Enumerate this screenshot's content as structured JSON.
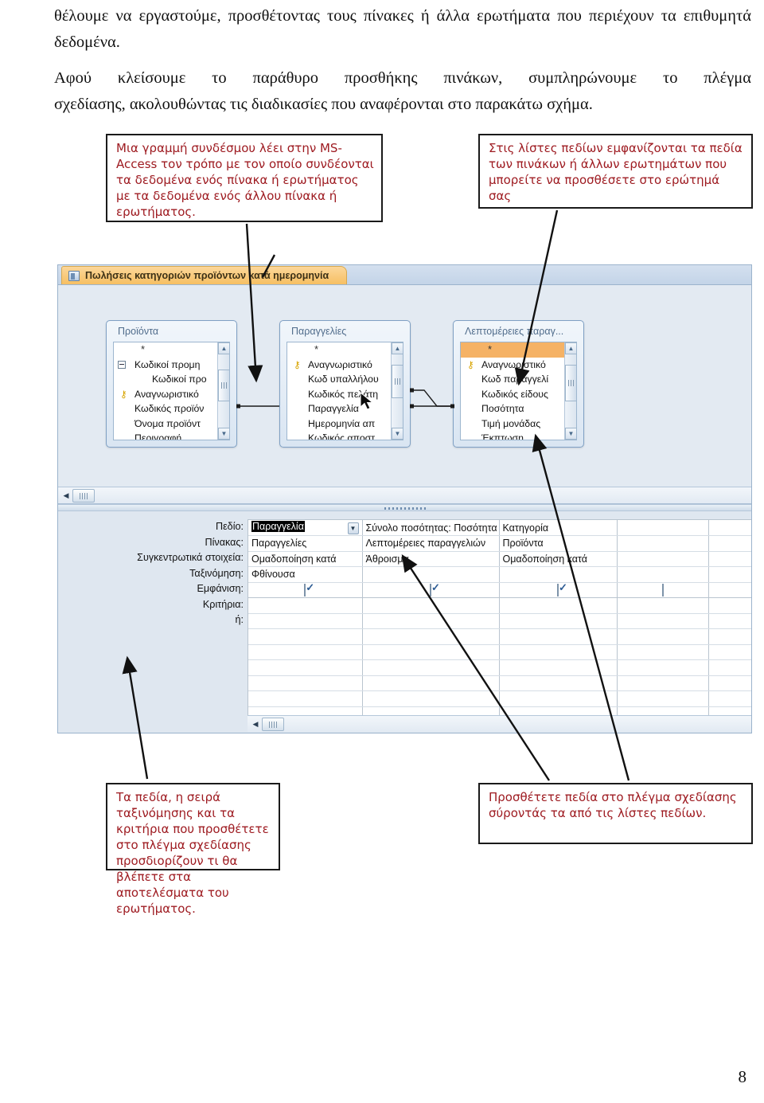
{
  "document": {
    "paragraph_1": "θέλουμε να εργαστούμε, προσθέτοντας τους πίνακες ή άλλα ερωτήματα που περιέχουν τα επιθυμητά δεδομένα.",
    "paragraph_2_line_1": "Αφού κλείσουμε το παράθυρο προσθήκης πινάκων, συμπληρώνουμε το πλέγμα",
    "paragraph_2_line_2": "σχεδίασης, ακολουθώντας τις διαδικασίες που αναφέρονται στο παρακάτω σχήμα.",
    "page_number": "8"
  },
  "callouts": {
    "link_line": "Μια γραμμή συνδέσμου λέει στην MS-Access τον τρόπο με τον οποίο συνδέονται τα δεδομένα ενός πίνακα ή ερωτήματος με τα δεδομένα ενός άλλου πίνακα ή ερωτήματος.",
    "field_lists": "Στις λίστες πεδίων εμφανίζονται τα πεδία των πινάκων ή άλλων ερωτημάτων που μπορείτε να προσθέσετε στο ερώτημά σας",
    "design_grid": "Τα πεδία, η σειρά ταξινόμησης και τα κριτήρια που προσθέτετε στο πλέγμα σχεδίασης προσδιορίζουν τι θα βλέπετε στα αποτελέσματα του ερωτήματος.",
    "drag_fields": "Προσθέτετε πεδία στο πλέγμα σχεδίασης σύροντάς τα από τις λίστες πεδίων."
  },
  "access_window": {
    "document_tab": {
      "label": "Πωλήσεις κατηγοριών προϊόντων κατά ημερομηνία",
      "icon": "query-icon"
    },
    "tables": [
      {
        "title": "Προϊόντα",
        "fields": [
          {
            "label": "*",
            "type": "star"
          },
          {
            "label": "Κωδικοί προμη",
            "type": "expander"
          },
          {
            "label": "Κωδικοί προ",
            "type": "indent"
          },
          {
            "label": "Αναγνωριστικό",
            "type": "key"
          },
          {
            "label": "Κωδικός προϊόν",
            "type": "plain"
          },
          {
            "label": "Όνομα προϊόντ",
            "type": "plain"
          },
          {
            "label": "Περιγραφή",
            "type": "plain"
          }
        ]
      },
      {
        "title": "Παραγγελίες",
        "fields": [
          {
            "label": "*",
            "type": "star"
          },
          {
            "label": "Αναγνωριστικό",
            "type": "key"
          },
          {
            "label": "Κωδ υπαλλήλου",
            "type": "plain"
          },
          {
            "label": "Κωδικός πελάτη",
            "type": "plain"
          },
          {
            "label": "Παραγγελία",
            "type": "plain"
          },
          {
            "label": "Ημερομηνία απ",
            "type": "plain"
          },
          {
            "label": "Κωδικός αποστ",
            "type": "plain"
          }
        ]
      },
      {
        "title": "Λεπτομέρειες παραγ...",
        "fields": [
          {
            "label": "*",
            "type": "star-selected"
          },
          {
            "label": "Αναγνωριστικό",
            "type": "key"
          },
          {
            "label": "Κωδ παραγγελί",
            "type": "plain"
          },
          {
            "label": "Κωδικός είδους",
            "type": "plain"
          },
          {
            "label": "Ποσότητα",
            "type": "plain"
          },
          {
            "label": "Τιμή μονάδας",
            "type": "plain"
          },
          {
            "label": "Έκπτωση",
            "type": "plain"
          }
        ]
      }
    ],
    "design_grid": {
      "row_labels": [
        "Πεδίο:",
        "Πίνακας:",
        "Συγκεντρωτικά στοιχεία:",
        "Ταξινόμηση:",
        "Εμφάνιση:",
        "Κριτήρια:",
        "ή:"
      ],
      "columns": [
        {
          "field": "Παραγγελία",
          "field_selected": true,
          "has_combo": true,
          "table": "Παραγγελίες",
          "total": "Ομαδοποίηση κατά",
          "sort": "Φθίνουσα",
          "show": true
        },
        {
          "field": "Σύνολο ποσότητας: Ποσότητα",
          "field_selected": false,
          "has_combo": false,
          "table": "Λεπτομέρειες παραγγελιών",
          "total": "Άθροισμα",
          "sort": "",
          "show": true
        },
        {
          "field": "Κατηγορία",
          "field_selected": false,
          "has_combo": false,
          "table": "Προϊόντα",
          "total": "Ομαδοποίηση κατά",
          "sort": "",
          "show": true
        },
        {
          "field": "",
          "field_selected": false,
          "has_combo": false,
          "table": "",
          "total": "",
          "sort": "",
          "show": false
        },
        {
          "field": "",
          "field_selected": false,
          "has_combo": false,
          "table": "",
          "total": "",
          "sort": "",
          "show": false
        }
      ]
    }
  },
  "colors": {
    "callout_text": "#9e1b21",
    "tab_accent": "#f6bf62",
    "selected_row": "#f5b265",
    "pane_background": "#dfe7f0"
  }
}
